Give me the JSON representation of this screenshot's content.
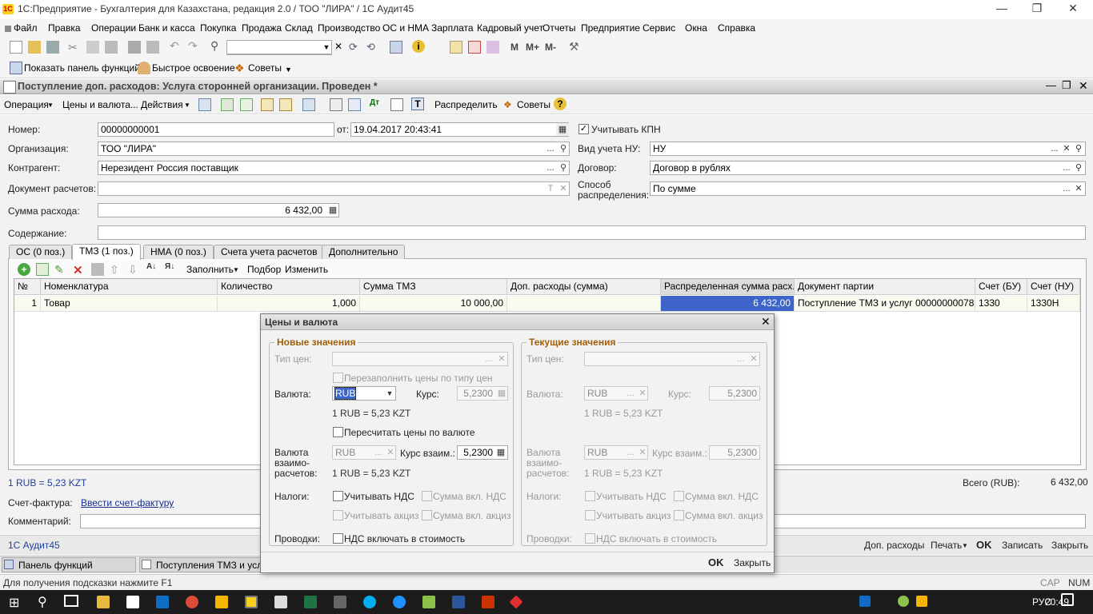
{
  "window": {
    "title": "1С:Предприятие - Бухгалтерия для Казахстана, редакция 2.0 / ТОО \"ЛИРА\" / 1С Аудит45",
    "app_icon": "1С"
  },
  "menu": [
    "Файл",
    "Правка",
    "Операции",
    "Банк и касса",
    "Покупка",
    "Продажа",
    "Склад",
    "Производство",
    "ОС и НМА",
    "Зарплата",
    "Кадровый учет",
    "Отчеты",
    "Предприятие",
    "Сервис",
    "Окна",
    "Справка"
  ],
  "toolbar2": {
    "show_panel": "Показать панель функций",
    "quick_start": "Быстрое освоение",
    "tips": "Советы"
  },
  "toolbar1": {
    "m": "M",
    "mplus": "M+",
    "mminus": "M-"
  },
  "document": {
    "title": "Поступление доп. расходов: Услуга сторонней организации. Проведен *",
    "toolbar": {
      "operation": "Операция",
      "prices_currency": "Цены и валюта...",
      "actions": "Действия",
      "distribute": "Распределить",
      "tips": "Советы",
      "help": "?"
    },
    "fields": {
      "number_label": "Номер:",
      "number": "00000000001",
      "date_label": "от:",
      "date": "19.04.2017 20:43:41",
      "kpn_label": "Учитывать КПН",
      "kpn_checked": true,
      "org_label": "Организация:",
      "org": "ТОО \"ЛИРА\"",
      "nu_label": "Вид учета НУ:",
      "nu": "НУ",
      "counterparty_label": "Контрагент:",
      "counterparty": "Нерезидент Россия поставщик",
      "contract_label": "Договор:",
      "contract": "Договор в рублях",
      "settlement_doc_label": "Документ расчетов:",
      "settlement_doc": "",
      "distribution_label_1": "Способ",
      "distribution_label_2": "распределения:",
      "distribution": "По сумме",
      "amount_label": "Сумма расхода:",
      "amount": "6 432,00",
      "content_label": "Содержание:",
      "content": ""
    },
    "tabs": [
      "ОС (0 поз.)",
      "ТМЗ (1 поз.)",
      "НМА (0 поз.)",
      "Счета учета расчетов",
      "Дополнительно"
    ],
    "active_tab": 1,
    "grid_toolbar": {
      "fill": "Заполнить",
      "select": "Подбор",
      "change": "Изменить"
    },
    "grid": {
      "headers": [
        "№",
        "Номенклатура",
        "Количество",
        "Сумма ТМЗ",
        "Доп. расходы (сумма)",
        "Распределенная сумма расх...",
        "Документ партии",
        "Счет (БУ)",
        "Счет (НУ)"
      ],
      "rows": [
        [
          "1",
          "Товар",
          "1,000",
          "10 000,00",
          "",
          "6 432,00",
          "Поступление ТМЗ и услуг 00000000078 о...",
          "1330",
          "1330Н"
        ]
      ]
    },
    "rate_info": "1 RUB = 5,23 KZT",
    "total_label": "Всего (RUB):",
    "total": "6 432,00",
    "invoice_label": "Счет-фактура:",
    "invoice_link": "Ввести счет-фактуру",
    "comment_label": "Комментарий:",
    "comment": "",
    "bottom": {
      "audit": "1С Аудит45",
      "extra": "Доп. расходы",
      "print": "Печать",
      "ok": "OK",
      "save": "Записать",
      "close": "Закрыть"
    }
  },
  "dialog": {
    "title": "Цены и валюта",
    "new_group": "Новые значения",
    "current_group": "Текущие значения",
    "price_type_label": "Тип цен:",
    "refill_label": "Перезаполнить цены по типу цен",
    "currency_label": "Валюта:",
    "currency_new": "RUB",
    "rate_label": "Курс:",
    "rate_new": "5,2300",
    "rate_text": "1 RUB = 5,23 KZT",
    "recalc_label": "Пересчитать цены по валюте",
    "settle_currency_label_1": "Валюта",
    "settle_currency_label_2": "взаимо-",
    "settle_currency_label_3": "расчетов:",
    "settle_currency": "RUB",
    "settle_rate_label": "Курс взаим.:",
    "settle_rate": "5,2300",
    "settle_rate_text": "1 RUB = 5,23 KZT",
    "taxes_label": "Налоги:",
    "vat_label": "Учитывать НДС",
    "vat_incl_label": "Сумма вкл. НДС",
    "excise_label": "Учитывать акциз",
    "excise_incl_label": "Сумма вкл. акциз",
    "postings_label": "Проводки:",
    "vat_cost_label": "НДС включать в стоимость",
    "current_currency": "RUB",
    "current_rate": "5,2300",
    "current_rate_text": "1 RUB = 5,23 KZT",
    "current_settle_currency": "RUB",
    "current_settle_rate": "5,2300",
    "current_settle_rate_text": "1 RUB = 5,23 KZT",
    "ok": "OK",
    "close": "Закрыть"
  },
  "panel_tabs": [
    "Панель функций",
    "Поступления ТМЗ и услуг"
  ],
  "status": {
    "hint": "Для получения подсказки нажмите F1",
    "cap": "CAP",
    "num": "NUM"
  },
  "taskbar": {
    "lang": "РУС",
    "time": "20:49"
  }
}
